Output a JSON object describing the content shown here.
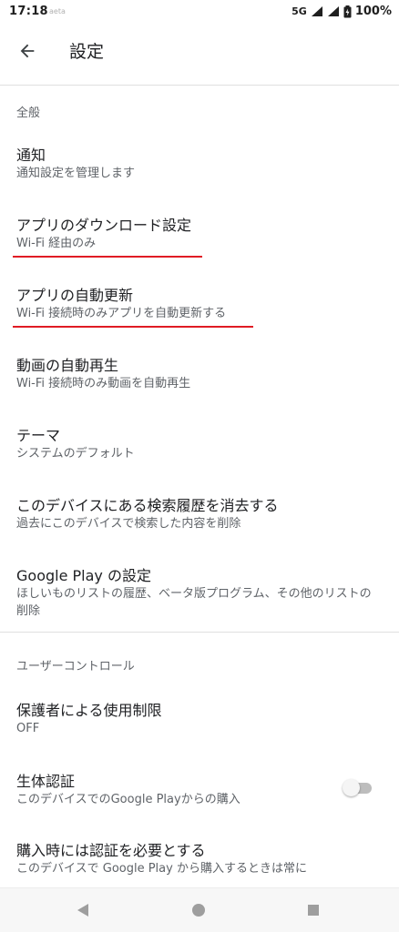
{
  "status_bar": {
    "time": "17:18",
    "carrier": "aeta",
    "network": "5G",
    "battery": "100%"
  },
  "app_bar": {
    "title": "設定",
    "back_icon": "arrow-back-icon"
  },
  "sections": {
    "general": {
      "header": "全般",
      "items": [
        {
          "title": "通知",
          "subtitle": "通知設定を管理します"
        },
        {
          "title": "アプリのダウンロード設定",
          "subtitle": "Wi-Fi 経由のみ"
        },
        {
          "title": "アプリの自動更新",
          "subtitle": "Wi-Fi 接続時のみアプリを自動更新する"
        },
        {
          "title": "動画の自動再生",
          "subtitle": "Wi-Fi 接続時のみ動画を自動再生"
        },
        {
          "title": "テーマ",
          "subtitle": "システムのデフォルト"
        },
        {
          "title": "このデバイスにある検索履歴を消去する",
          "subtitle": "過去にこのデバイスで検索した内容を削除"
        },
        {
          "title": "Google Play の設定",
          "subtitle": "ほしいものリストの履歴、ベータ版プログラム、その他のリストの削除"
        }
      ]
    },
    "user_controls": {
      "header": "ユーザーコントロール",
      "items": [
        {
          "title": "保護者による使用制限",
          "subtitle": "OFF"
        },
        {
          "title": "生体認証",
          "subtitle": "このデバイスでのGoogle Playからの購入",
          "toggle_on": false
        },
        {
          "title": "購入時には認証を必要とする",
          "subtitle": "このデバイスで Google Play から購入するときは常に"
        }
      ]
    }
  },
  "highlight_color": "#e01b24",
  "nav_bar": {
    "icons": [
      "back-triangle-icon",
      "home-circle-icon",
      "recents-square-icon"
    ]
  }
}
